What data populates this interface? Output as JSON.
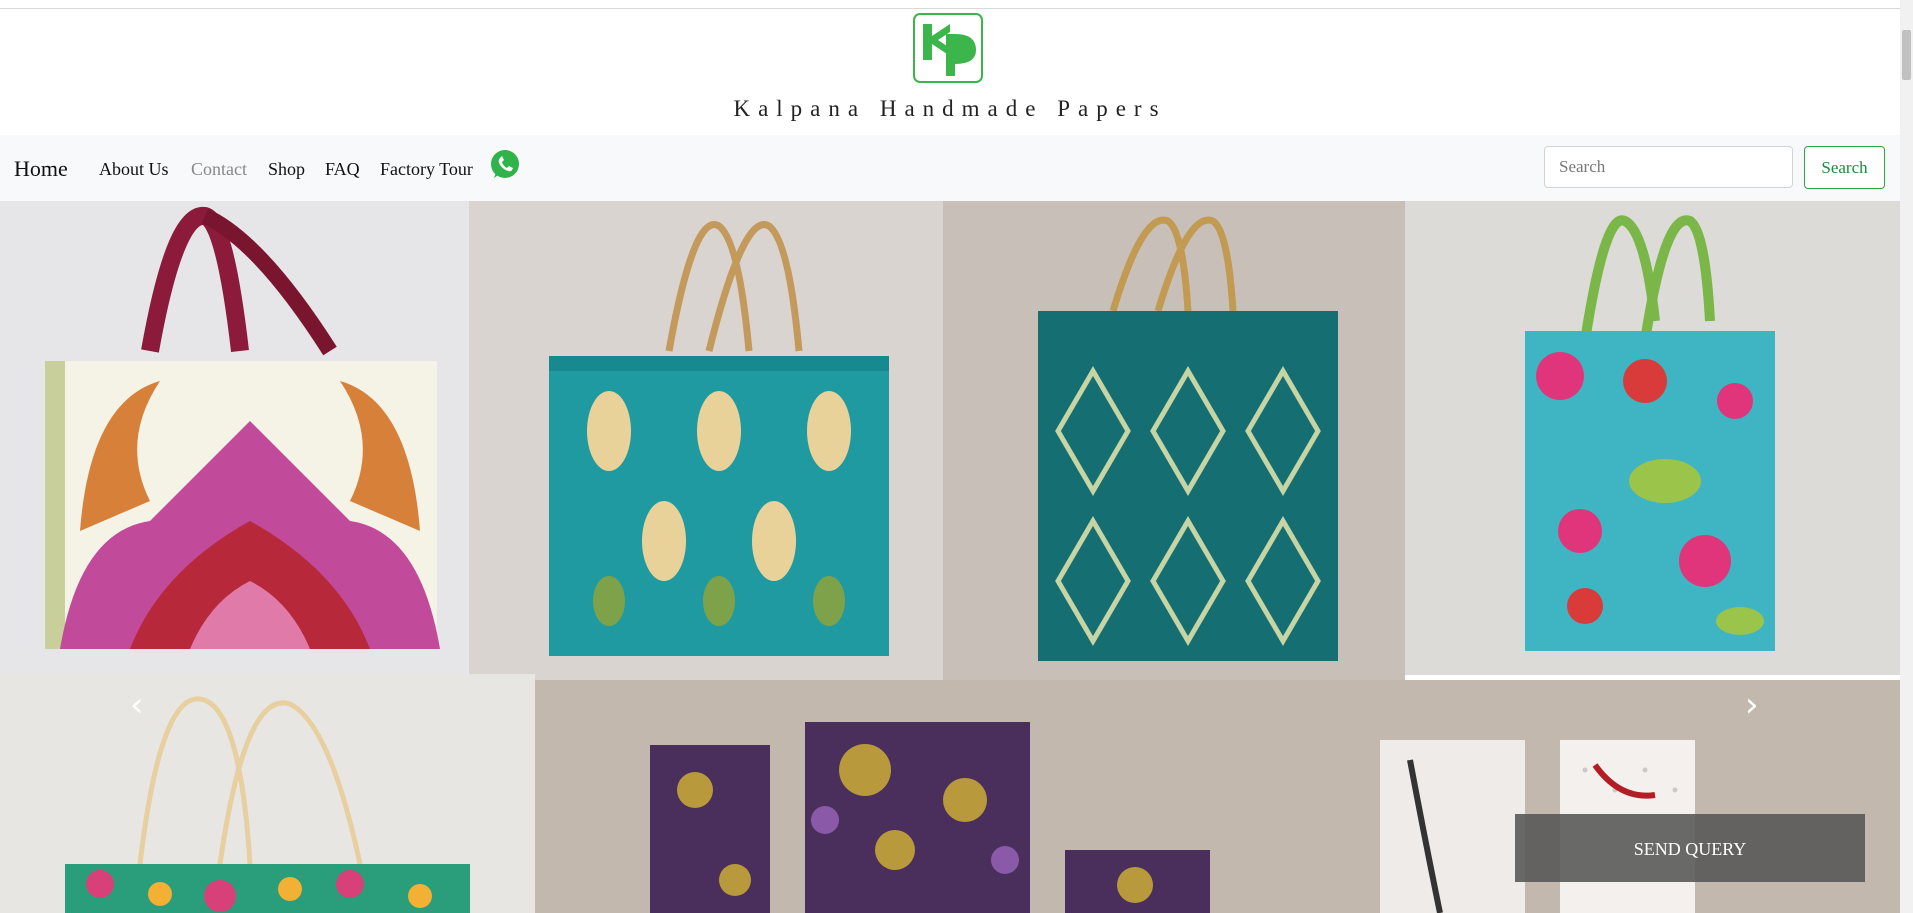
{
  "brand": {
    "name": "Kalpana Handmade Papers",
    "logo_icon": "kp-logo-icon",
    "logo_color": "#3cb54a"
  },
  "nav": {
    "home": "Home",
    "links": [
      "About Us",
      "Contact",
      "Shop",
      "FAQ",
      "Factory Tour"
    ],
    "whatsapp_icon": "whatsapp-icon"
  },
  "search": {
    "placeholder": "Search",
    "button": "Search"
  },
  "gallery": {
    "products": [
      "paisley-print-gift-bag",
      "teal-ikat-gift-bag",
      "teal-damask-gift-bag",
      "floral-turquoise-gift-bag",
      "multicolor-gift-bag",
      "purple-gold-gift-bags",
      "silver-dot-gift-bags"
    ],
    "prev_arrow": "‹",
    "next_arrow": "›"
  },
  "query_button": "SEND QUERY",
  "colors": {
    "accent_green": "#28a745",
    "navbar_bg": "#f8f9fa"
  }
}
